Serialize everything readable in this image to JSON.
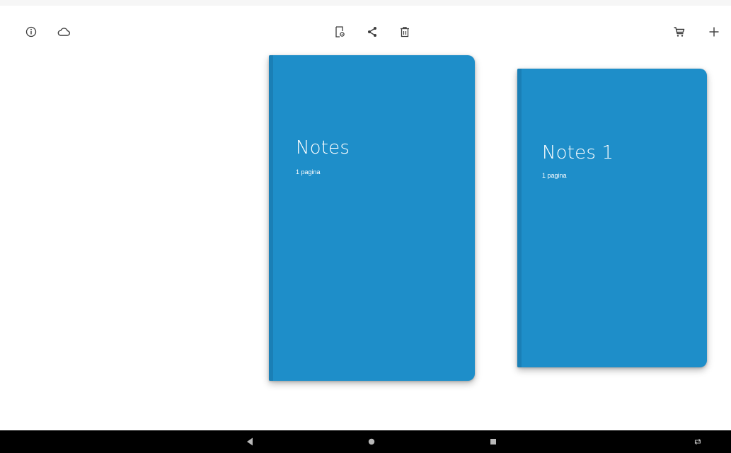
{
  "toolbar": {
    "left_icons": [
      "info-icon",
      "cloud-icon"
    ],
    "center_icons": [
      "notebook-settings-icon",
      "share-icon",
      "delete-icon"
    ],
    "right_icons": [
      "cart-icon",
      "add-icon"
    ],
    "icon_color": "#3c3c3c"
  },
  "notebooks": [
    {
      "title": "Notes",
      "pages_label": "1 pagina",
      "cover_color": "#1e8ec9",
      "selected": true
    },
    {
      "title": "Notes 1",
      "pages_label": "1 pagina",
      "cover_color": "#1e8ec9",
      "selected": false
    }
  ],
  "navigation_bar": {
    "buttons": [
      "back-icon",
      "home-icon",
      "recents-icon",
      "rotate-icon"
    ],
    "background": "#000000"
  }
}
